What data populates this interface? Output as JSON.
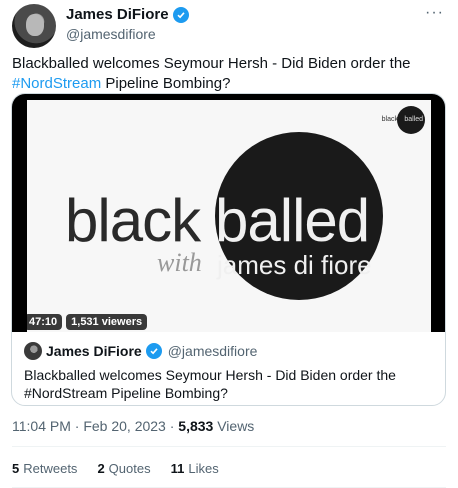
{
  "author": {
    "name": "James DiFiore",
    "handle": "@jamesdifiore"
  },
  "more_label": "···",
  "tweet": {
    "text_before": "Blackballed welcomes Seymour Hersh - Did Biden order the ",
    "hashtag": "#NordStream",
    "text_after": " Pipeline Bombing?"
  },
  "video": {
    "brand_left": "black",
    "brand_right": "balled",
    "with_text": "with",
    "host_text": "james di fiore",
    "mini_logo_left": "black",
    "mini_logo_right": "balled",
    "duration": "47:10",
    "viewers": "1,531 viewers"
  },
  "quote": {
    "name": "James DiFiore",
    "handle": "@jamesdifiore",
    "text": "Blackballed welcomes Seymour Hersh - Did Biden order the #NordStream Pipeline Bombing?"
  },
  "meta": {
    "time": "11:04 PM · Feb 20, 2023 · ",
    "views_count": "5,833",
    "views_label": " Views"
  },
  "stats": [
    {
      "count": "5",
      "label": "Retweets"
    },
    {
      "count": "2",
      "label": "Quotes"
    },
    {
      "count": "11",
      "label": "Likes"
    }
  ],
  "colors": {
    "accent": "#1d9bf0",
    "text": "#0f1419",
    "muted": "#536471"
  }
}
